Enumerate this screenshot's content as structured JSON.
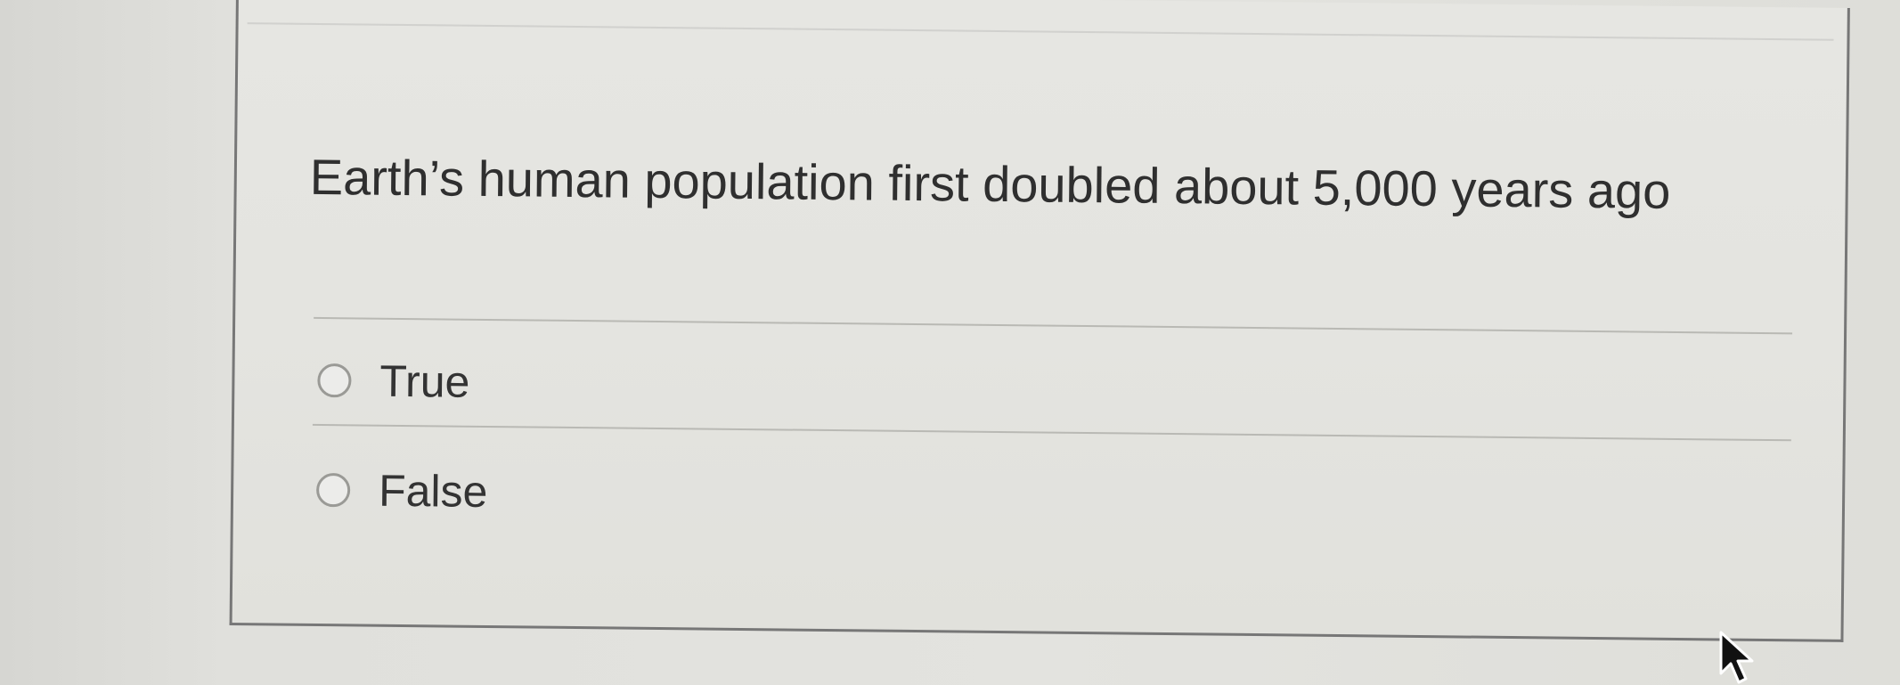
{
  "question": {
    "text": "Earth’s human population first doubled about 5,000 years ago"
  },
  "options": [
    {
      "label": "True",
      "selected": false
    },
    {
      "label": "False",
      "selected": false
    }
  ],
  "colors": {
    "background": "#e3e3df",
    "border": "#777777",
    "text": "#2f2f2f"
  },
  "icons": {
    "cursor": "arrow-cursor-icon"
  }
}
